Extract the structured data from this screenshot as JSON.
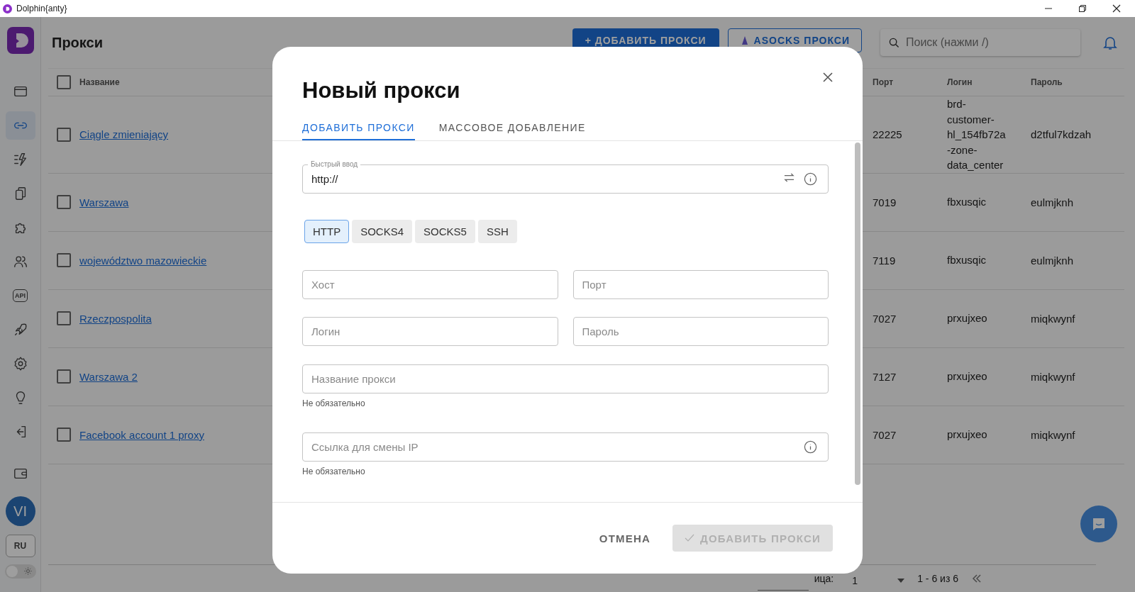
{
  "window": {
    "title": "Dolphin{anty}"
  },
  "sidebar": {
    "items": [
      {
        "selected": false
      },
      {
        "selected": true
      },
      {
        "selected": false
      },
      {
        "selected": false
      },
      {
        "selected": false
      },
      {
        "selected": false
      },
      {
        "selected": false
      },
      {
        "selected": false
      },
      {
        "selected": false
      },
      {
        "selected": false
      },
      {
        "selected": false
      },
      {
        "selected": false
      }
    ],
    "api_label": "API",
    "avatar": "VI",
    "language": "RU",
    "dark_theme": false
  },
  "header": {
    "title": "Прокси",
    "add_button": "+ ДОБАВИТЬ ПРОКСИ",
    "asocks_button": "ASOCKS ПРОКСИ",
    "search": {
      "placeholder": "Поиск (нажми /)"
    }
  },
  "table": {
    "columns": [
      "Название",
      "Порт",
      "Логин",
      "Пароль"
    ],
    "rows": [
      {
        "name": "Ciągle zmieniający",
        "port": "22225",
        "login": "brd-customer-hl_154fb72a-zone-data_center",
        "password": "d2tful7kdzah",
        "checked": false
      },
      {
        "name": "Warszawa",
        "port": "7019",
        "login": "fbxusqic",
        "password": "eulmjknh",
        "checked": false
      },
      {
        "name": "województwo mazowieckie",
        "port": "7119",
        "login": "fbxusqic",
        "password": "eulmjknh",
        "checked": false
      },
      {
        "name": "Rzeczpospolita",
        "port": "7027",
        "login": "prxujxeo",
        "password": "miqkwynf",
        "checked": false
      },
      {
        "name": "Warszawa 2",
        "port": "7127",
        "login": "prxujxeo",
        "password": "miqkwynf",
        "checked": false
      },
      {
        "name": "Facebook account 1 proxy",
        "port": "7027",
        "login": "prxujxeo",
        "password": "miqkwynf",
        "checked": false
      }
    ],
    "all_checked": false
  },
  "pagination": {
    "rows_label": "ица:",
    "page": "1",
    "range": "1 - 6 из 6"
  },
  "dialog": {
    "title": "Новый прокси",
    "tabs": [
      {
        "label": "ДОБАВИТЬ ПРОКСИ",
        "selected": true
      },
      {
        "label": "МАССОВОЕ ДОБАВЛЕНИЕ",
        "selected": false
      }
    ],
    "quick_input": {
      "label": "Быстрый ввод",
      "value": "http://"
    },
    "protocols": [
      {
        "label": "HTTP",
        "selected": true
      },
      {
        "label": "SOCKS4",
        "selected": false
      },
      {
        "label": "SOCKS5",
        "selected": false
      },
      {
        "label": "SSH",
        "selected": false
      }
    ],
    "host": {
      "placeholder": "Хост"
    },
    "port": {
      "placeholder": "Порт"
    },
    "login": {
      "placeholder": "Логин"
    },
    "password": {
      "placeholder": "Пароль"
    },
    "name": {
      "placeholder": "Название прокси",
      "helper": "Не обязательно"
    },
    "change_ip_link": {
      "placeholder": "Ссылка для смены IP",
      "helper": "Не обязательно"
    },
    "cancel_button": "ОТМЕНА",
    "submit_button": {
      "label": "ДОБАВИТЬ ПРОКСИ",
      "disabled": true
    }
  }
}
